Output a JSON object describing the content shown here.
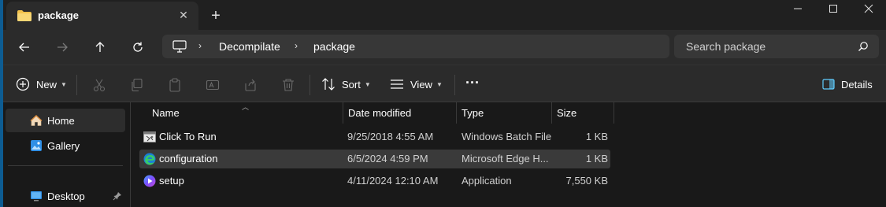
{
  "tab": {
    "title": "package",
    "close_glyph": "✕",
    "new_tab_glyph": "+"
  },
  "window": {
    "minimize": "─",
    "maximize": "☐",
    "close": "✕"
  },
  "address": {
    "segments": [
      "Decompilate",
      "package"
    ],
    "separator": "›"
  },
  "search": {
    "placeholder": "Search package"
  },
  "toolbar": {
    "new_label": "New",
    "sort_label": "Sort",
    "view_label": "View",
    "more_label": "···",
    "details_label": "Details"
  },
  "sidebar": {
    "items": [
      {
        "label": "Home",
        "icon": "home-icon"
      },
      {
        "label": "Gallery",
        "icon": "gallery-icon"
      },
      {
        "label": "Desktop",
        "icon": "desktop-icon"
      }
    ]
  },
  "columns": {
    "name": "Name",
    "date": "Date modified",
    "type": "Type",
    "size": "Size"
  },
  "files": [
    {
      "name": "Click To Run",
      "date": "9/25/2018 4:55 AM",
      "type": "Windows Batch File",
      "size": "1 KB",
      "icon": "batch-file-icon"
    },
    {
      "name": "configuration",
      "date": "6/5/2024 4:59 PM",
      "type": "Microsoft Edge H...",
      "size": "1 KB",
      "icon": "edge-html-icon"
    },
    {
      "name": "setup",
      "date": "4/11/2024 12:10 AM",
      "type": "Application",
      "size": "7,550 KB",
      "icon": "setup-app-icon"
    }
  ],
  "colors": {
    "accent": "#0d5c92",
    "folder": "#f3c24c",
    "selection": "#3a3a3a"
  }
}
